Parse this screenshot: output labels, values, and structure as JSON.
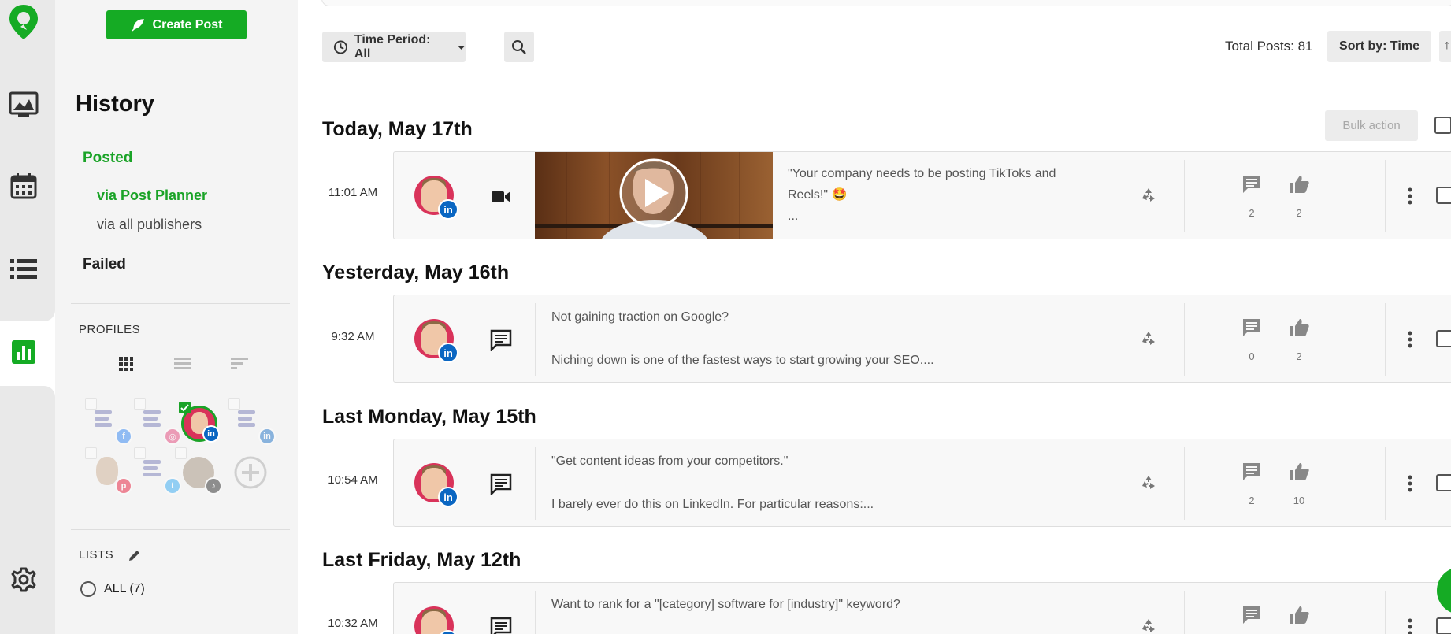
{
  "sidebar": {
    "create_post": "Create Post",
    "history_title": "History",
    "nav": {
      "posted": "Posted",
      "via_post_planner": "via Post Planner",
      "via_all_publishers": "via all publishers",
      "failed": "Failed"
    },
    "profiles_label": "PROFILES",
    "lists_label": "LISTS",
    "lists_all": "ALL (7)"
  },
  "toolbar": {
    "time_period": "Time Period: All",
    "total_posts": "Total Posts: 81",
    "sort_by": "Sort by: Time",
    "sort_dir_glyph": "↑",
    "bulk_action": "Bulk action"
  },
  "groups": [
    {
      "heading": "Today, May 17th",
      "posts": [
        {
          "time": "11:01 AM",
          "type": "video",
          "line1": "\"Your company needs to be posting TikToks and",
          "line2": "Reels!\" 🤩",
          "line3": "...",
          "comments": "2",
          "likes": "2"
        }
      ]
    },
    {
      "heading": "Yesterday, May 16th",
      "posts": [
        {
          "time": "9:32 AM",
          "type": "text",
          "line1": "Not gaining traction on Google?",
          "line2": "Niching down is one of the fastest ways to start growing your SEO....",
          "comments": "0",
          "likes": "2"
        }
      ]
    },
    {
      "heading": "Last Monday, May 15th",
      "posts": [
        {
          "time": "10:54 AM",
          "type": "text",
          "line1": "\"Get content ideas from your competitors.\"",
          "line2": "I barely ever do this on LinkedIn. For particular reasons:...",
          "comments": "2",
          "likes": "10"
        }
      ]
    },
    {
      "heading": "Last Friday, May 12th",
      "posts": [
        {
          "time": "10:32 AM",
          "type": "text",
          "line1": "Want to rank for a \"[category] software for [industry]\" keyword?"
        }
      ]
    }
  ],
  "colors": {
    "brand_green": "#15ab24",
    "linkedin_blue": "#0a66c2"
  }
}
